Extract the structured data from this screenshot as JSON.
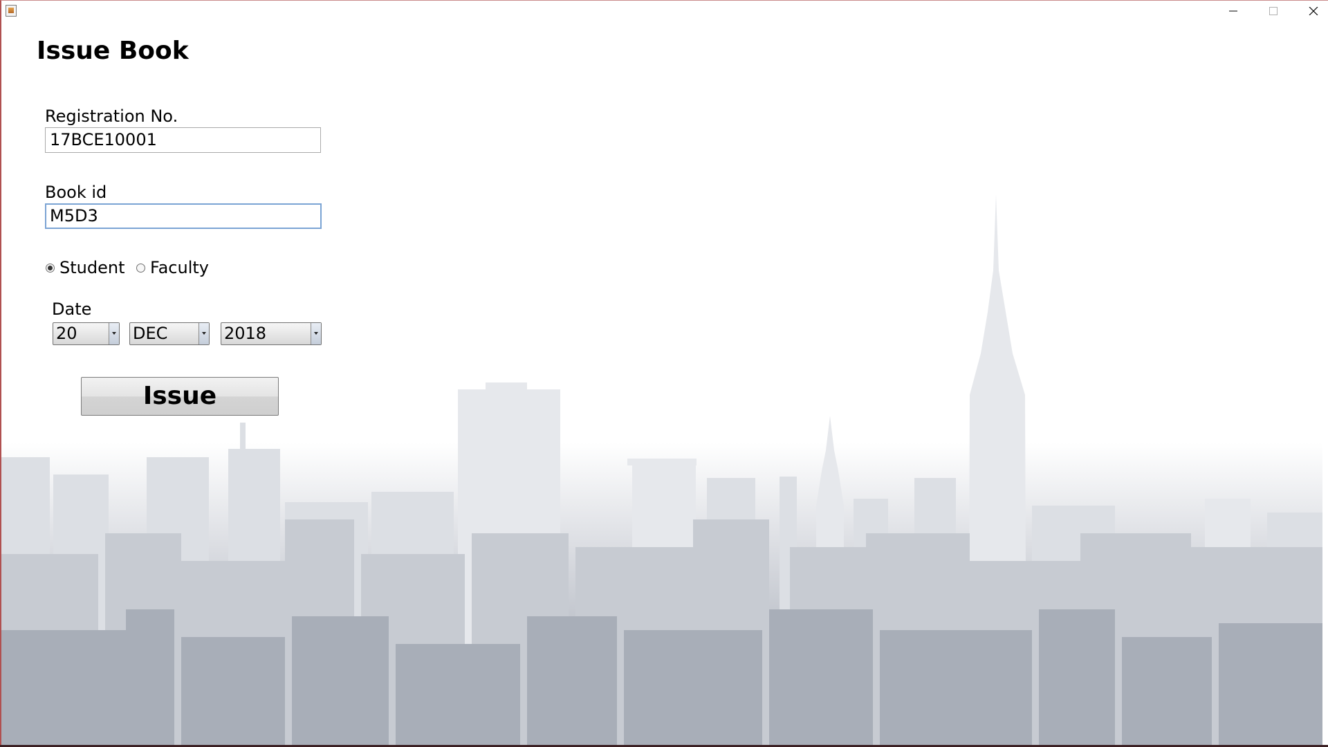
{
  "window": {
    "icon": "java-cup-icon",
    "controls": {
      "minimize": "minimize-icon",
      "maximize": "maximize-icon",
      "close": "close-icon"
    }
  },
  "form": {
    "title": "Issue Book",
    "registration": {
      "label": "Registration No.",
      "value": "17BCE10001"
    },
    "book_id": {
      "label": "Book id",
      "value": "M5D3"
    },
    "user_type": {
      "options": [
        {
          "label": "Student",
          "selected": true
        },
        {
          "label": "Faculty",
          "selected": false
        }
      ]
    },
    "date": {
      "label": "Date",
      "day": "20",
      "month": "DEC",
      "year": "2018"
    },
    "submit_label": "Issue"
  },
  "colors": {
    "window_border": "#b05050",
    "focus_border": "#7aa3d4",
    "skyline": "#8e96a3"
  }
}
